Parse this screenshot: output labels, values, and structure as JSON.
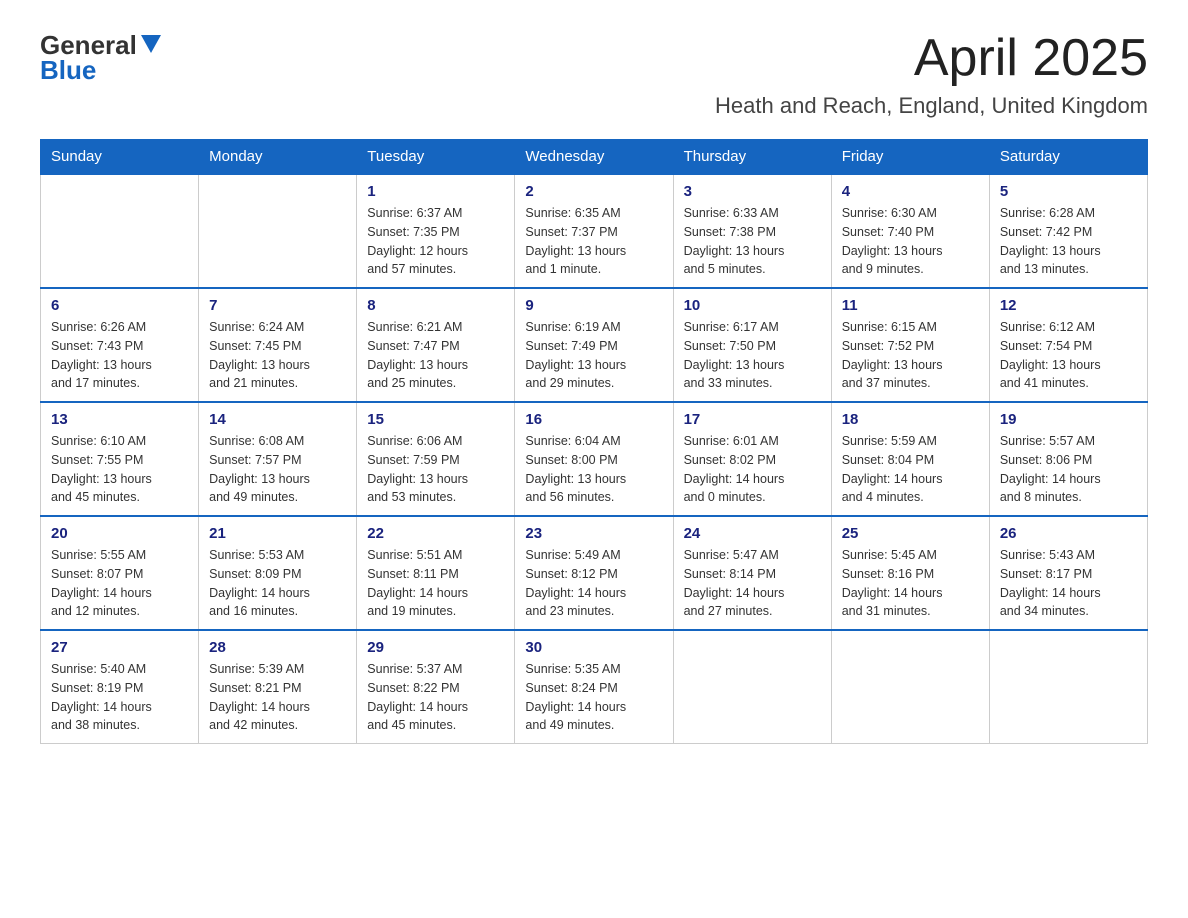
{
  "logo": {
    "general": "General",
    "blue": "Blue"
  },
  "title": "April 2025",
  "subtitle": "Heath and Reach, England, United Kingdom",
  "weekdays": [
    "Sunday",
    "Monday",
    "Tuesday",
    "Wednesday",
    "Thursday",
    "Friday",
    "Saturday"
  ],
  "weeks": [
    [
      {
        "day": "",
        "info": ""
      },
      {
        "day": "",
        "info": ""
      },
      {
        "day": "1",
        "info": "Sunrise: 6:37 AM\nSunset: 7:35 PM\nDaylight: 12 hours\nand 57 minutes."
      },
      {
        "day": "2",
        "info": "Sunrise: 6:35 AM\nSunset: 7:37 PM\nDaylight: 13 hours\nand 1 minute."
      },
      {
        "day": "3",
        "info": "Sunrise: 6:33 AM\nSunset: 7:38 PM\nDaylight: 13 hours\nand 5 minutes."
      },
      {
        "day": "4",
        "info": "Sunrise: 6:30 AM\nSunset: 7:40 PM\nDaylight: 13 hours\nand 9 minutes."
      },
      {
        "day": "5",
        "info": "Sunrise: 6:28 AM\nSunset: 7:42 PM\nDaylight: 13 hours\nand 13 minutes."
      }
    ],
    [
      {
        "day": "6",
        "info": "Sunrise: 6:26 AM\nSunset: 7:43 PM\nDaylight: 13 hours\nand 17 minutes."
      },
      {
        "day": "7",
        "info": "Sunrise: 6:24 AM\nSunset: 7:45 PM\nDaylight: 13 hours\nand 21 minutes."
      },
      {
        "day": "8",
        "info": "Sunrise: 6:21 AM\nSunset: 7:47 PM\nDaylight: 13 hours\nand 25 minutes."
      },
      {
        "day": "9",
        "info": "Sunrise: 6:19 AM\nSunset: 7:49 PM\nDaylight: 13 hours\nand 29 minutes."
      },
      {
        "day": "10",
        "info": "Sunrise: 6:17 AM\nSunset: 7:50 PM\nDaylight: 13 hours\nand 33 minutes."
      },
      {
        "day": "11",
        "info": "Sunrise: 6:15 AM\nSunset: 7:52 PM\nDaylight: 13 hours\nand 37 minutes."
      },
      {
        "day": "12",
        "info": "Sunrise: 6:12 AM\nSunset: 7:54 PM\nDaylight: 13 hours\nand 41 minutes."
      }
    ],
    [
      {
        "day": "13",
        "info": "Sunrise: 6:10 AM\nSunset: 7:55 PM\nDaylight: 13 hours\nand 45 minutes."
      },
      {
        "day": "14",
        "info": "Sunrise: 6:08 AM\nSunset: 7:57 PM\nDaylight: 13 hours\nand 49 minutes."
      },
      {
        "day": "15",
        "info": "Sunrise: 6:06 AM\nSunset: 7:59 PM\nDaylight: 13 hours\nand 53 minutes."
      },
      {
        "day": "16",
        "info": "Sunrise: 6:04 AM\nSunset: 8:00 PM\nDaylight: 13 hours\nand 56 minutes."
      },
      {
        "day": "17",
        "info": "Sunrise: 6:01 AM\nSunset: 8:02 PM\nDaylight: 14 hours\nand 0 minutes."
      },
      {
        "day": "18",
        "info": "Sunrise: 5:59 AM\nSunset: 8:04 PM\nDaylight: 14 hours\nand 4 minutes."
      },
      {
        "day": "19",
        "info": "Sunrise: 5:57 AM\nSunset: 8:06 PM\nDaylight: 14 hours\nand 8 minutes."
      }
    ],
    [
      {
        "day": "20",
        "info": "Sunrise: 5:55 AM\nSunset: 8:07 PM\nDaylight: 14 hours\nand 12 minutes."
      },
      {
        "day": "21",
        "info": "Sunrise: 5:53 AM\nSunset: 8:09 PM\nDaylight: 14 hours\nand 16 minutes."
      },
      {
        "day": "22",
        "info": "Sunrise: 5:51 AM\nSunset: 8:11 PM\nDaylight: 14 hours\nand 19 minutes."
      },
      {
        "day": "23",
        "info": "Sunrise: 5:49 AM\nSunset: 8:12 PM\nDaylight: 14 hours\nand 23 minutes."
      },
      {
        "day": "24",
        "info": "Sunrise: 5:47 AM\nSunset: 8:14 PM\nDaylight: 14 hours\nand 27 minutes."
      },
      {
        "day": "25",
        "info": "Sunrise: 5:45 AM\nSunset: 8:16 PM\nDaylight: 14 hours\nand 31 minutes."
      },
      {
        "day": "26",
        "info": "Sunrise: 5:43 AM\nSunset: 8:17 PM\nDaylight: 14 hours\nand 34 minutes."
      }
    ],
    [
      {
        "day": "27",
        "info": "Sunrise: 5:40 AM\nSunset: 8:19 PM\nDaylight: 14 hours\nand 38 minutes."
      },
      {
        "day": "28",
        "info": "Sunrise: 5:39 AM\nSunset: 8:21 PM\nDaylight: 14 hours\nand 42 minutes."
      },
      {
        "day": "29",
        "info": "Sunrise: 5:37 AM\nSunset: 8:22 PM\nDaylight: 14 hours\nand 45 minutes."
      },
      {
        "day": "30",
        "info": "Sunrise: 5:35 AM\nSunset: 8:24 PM\nDaylight: 14 hours\nand 49 minutes."
      },
      {
        "day": "",
        "info": ""
      },
      {
        "day": "",
        "info": ""
      },
      {
        "day": "",
        "info": ""
      }
    ]
  ]
}
